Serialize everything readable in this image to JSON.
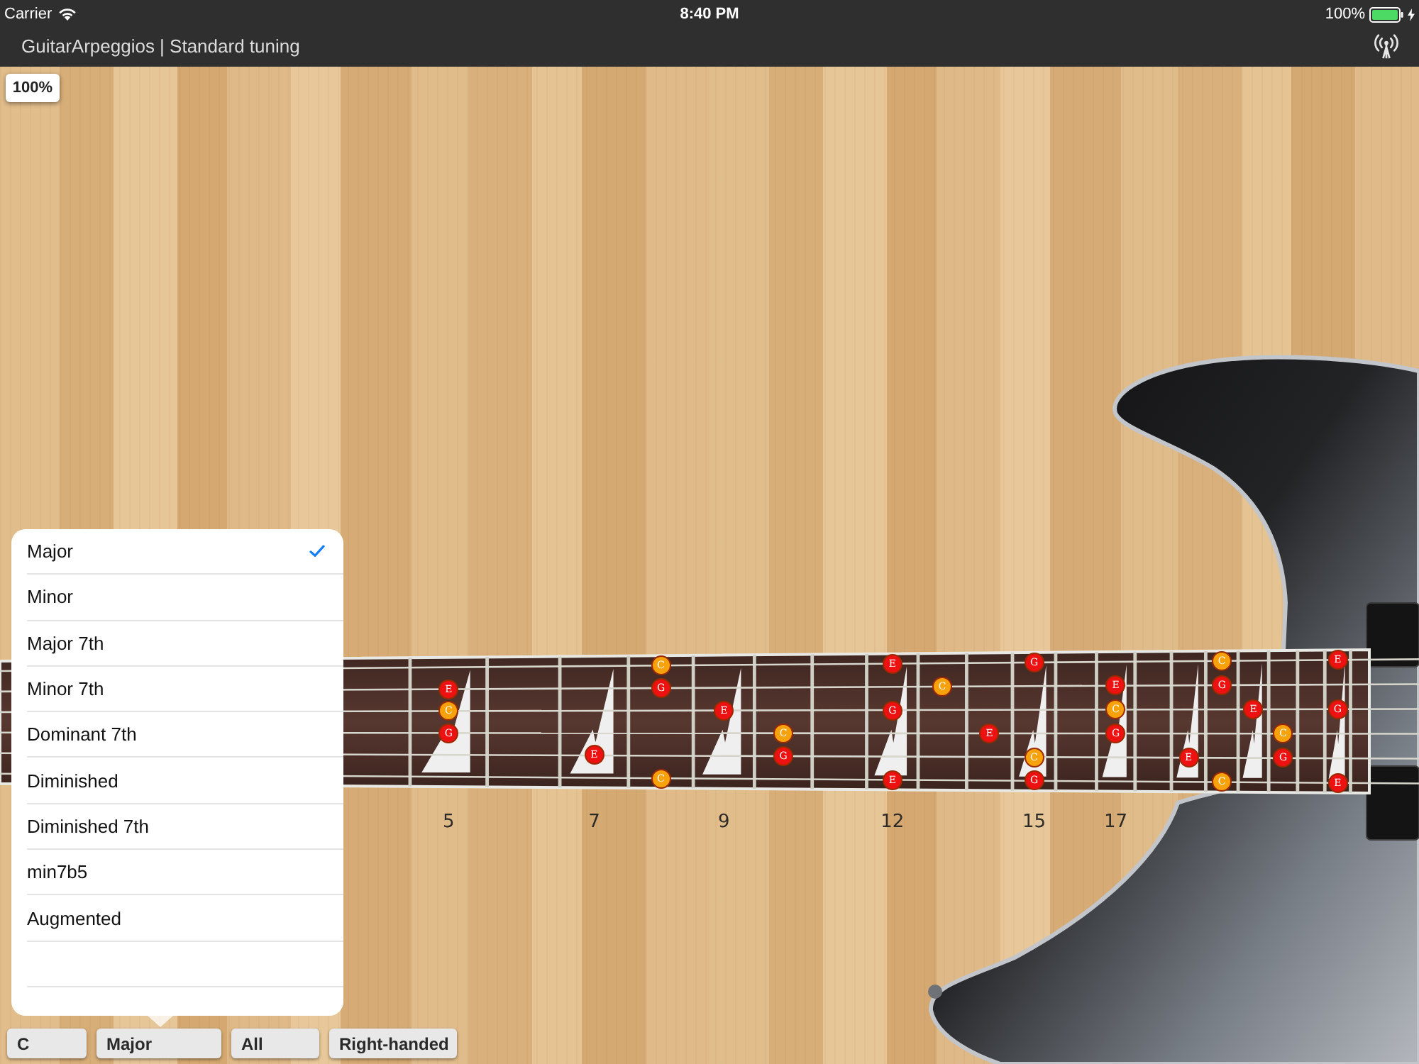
{
  "status_bar": {
    "carrier": "Carrier",
    "time": "8:40 PM",
    "battery": "100%"
  },
  "nav_bar": {
    "title": "GuitarArpeggios | Standard tuning"
  },
  "zoom_label": "100%",
  "fretboard": {
    "frets": [
      {
        "kind": "plain"
      },
      {
        "kind": "inlay",
        "label": "5",
        "string_2": {
          "note": "E",
          "color": "#ee1111"
        },
        "string_3": {
          "note": "C",
          "color": "#f7a20b"
        },
        "string_4": {
          "note": "G",
          "color": "#ee1111"
        }
      },
      {
        "kind": "plain"
      },
      {
        "kind": "inlay",
        "label": "7",
        "string_5": {
          "note": "E",
          "color": "#ee1111"
        }
      },
      {
        "kind": "plain",
        "string_1": {
          "note": "C",
          "color": "#f7a20b"
        },
        "string_2": {
          "note": "G",
          "color": "#ee1111"
        },
        "string_6": {
          "note": "C",
          "color": "#f7a20b"
        }
      },
      {
        "kind": "inlay",
        "label": "9",
        "string_3": {
          "note": "E",
          "color": "#ee1111"
        }
      },
      {
        "kind": "plain",
        "string_4": {
          "note": "C",
          "color": "#f7a20b"
        },
        "string_5": {
          "note": "G",
          "color": "#ee1111"
        }
      },
      {
        "kind": "plain"
      },
      {
        "kind": "inlay",
        "label": "12",
        "string_1": {
          "note": "E",
          "color": "#ee1111"
        },
        "string_3": {
          "note": "G",
          "color": "#ee1111"
        },
        "string_6": {
          "note": "E",
          "color": "#ee1111"
        }
      },
      {
        "kind": "plain",
        "string_2": {
          "note": "C",
          "color": "#f7a20b"
        }
      },
      {
        "kind": "plain",
        "string_4": {
          "note": "E",
          "color": "#ee1111"
        }
      },
      {
        "kind": "inlay",
        "label": "15",
        "string_1": {
          "note": "G",
          "color": "#ee1111"
        },
        "string_5": {
          "note": "C",
          "color": "#f7a20b"
        },
        "string_6": {
          "note": "G",
          "color": "#ee1111"
        }
      },
      {
        "kind": "plain"
      },
      {
        "kind": "inlay",
        "label": "17",
        "string_2": {
          "note": "E",
          "color": "#ee1111"
        },
        "string_3": {
          "note": "C",
          "color": "#f7a20b"
        },
        "string_4": {
          "note": "G",
          "color": "#ee1111"
        }
      },
      {
        "kind": "plain"
      },
      {
        "kind": "inlay",
        "string_5": {
          "note": "E",
          "color": "#ee1111"
        }
      },
      {
        "kind": "plain",
        "string_1": {
          "note": "C",
          "color": "#f7a20b"
        },
        "string_2": {
          "note": "G",
          "color": "#ee1111"
        },
        "string_6": {
          "note": "C",
          "color": "#f7a20b"
        }
      },
      {
        "kind": "inlay",
        "string_3": {
          "note": "E",
          "color": "#ee1111"
        }
      },
      {
        "kind": "plain",
        "string_4": {
          "note": "C",
          "color": "#f7a20b"
        },
        "string_5": {
          "note": "G",
          "color": "#ee1111"
        }
      },
      {
        "kind": "plain"
      },
      {
        "kind": "inlay",
        "string_1": {
          "note": "E",
          "color": "#ee1111"
        },
        "string_3": {
          "note": "G",
          "color": "#ee1111"
        },
        "string_6": {
          "note": "E",
          "color": "#ee1111"
        }
      }
    ]
  },
  "popover": {
    "items": [
      {
        "label": "Major",
        "selected": true
      },
      {
        "label": "Minor",
        "selected": false
      },
      {
        "label": "Major 7th",
        "selected": false
      },
      {
        "label": "Minor 7th",
        "selected": false
      },
      {
        "label": "Dominant 7th",
        "selected": false
      },
      {
        "label": "Diminished",
        "selected": false
      },
      {
        "label": "Diminished 7th",
        "selected": false
      },
      {
        "label": "min7b5",
        "selected": false
      },
      {
        "label": "Augmented",
        "selected": false
      }
    ]
  },
  "toolbar": {
    "buttons": [
      {
        "label": "C"
      },
      {
        "label": "Major"
      },
      {
        "label": "All"
      },
      {
        "label": "Right-handed"
      }
    ]
  }
}
